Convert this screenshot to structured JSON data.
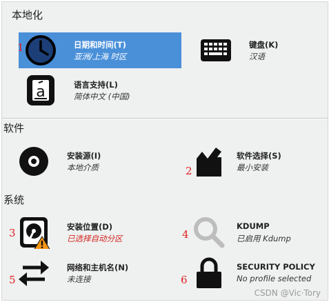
{
  "sections": {
    "localization": "本地化",
    "software": "软件",
    "system": "系统"
  },
  "spokes": {
    "datetime": {
      "title": "日期和时间(T)",
      "status": "亚洲/上海 时区",
      "marker": "1",
      "icon": "clock-icon"
    },
    "keyboard": {
      "title": "键盘(K)",
      "status": "汉语",
      "icon": "keyboard-icon"
    },
    "language": {
      "title": "语言支持(L)",
      "status": "简体中文 (中国)",
      "icon": "language-icon"
    },
    "source": {
      "title": "安装源(I)",
      "status": "本地介质",
      "icon": "disc-icon"
    },
    "software": {
      "title": "软件选择(S)",
      "status": "最小安装",
      "marker": "2",
      "icon": "package-icon"
    },
    "destination": {
      "title": "安装位置(D)",
      "status": "已选择自动分区",
      "marker": "3",
      "icon": "harddisk-warning-icon"
    },
    "kdump": {
      "title": "KDUMP",
      "status": "已启用 Kdump",
      "marker": "4",
      "icon": "magnifier-icon"
    },
    "network": {
      "title": "网络和主机名(N)",
      "status": "未连接",
      "marker": "5",
      "icon": "network-arrows-icon"
    },
    "security": {
      "title": "SECURITY POLICY",
      "status": "No profile selected",
      "marker": "6",
      "icon": "lock-icon"
    }
  },
  "watermark": "CSDN @Vic·Tory",
  "colors": {
    "selected_bg": "#4a90d9",
    "warning_text": "#d3241d",
    "marker": "#e02020",
    "panel_bg": "#eff0f0"
  }
}
